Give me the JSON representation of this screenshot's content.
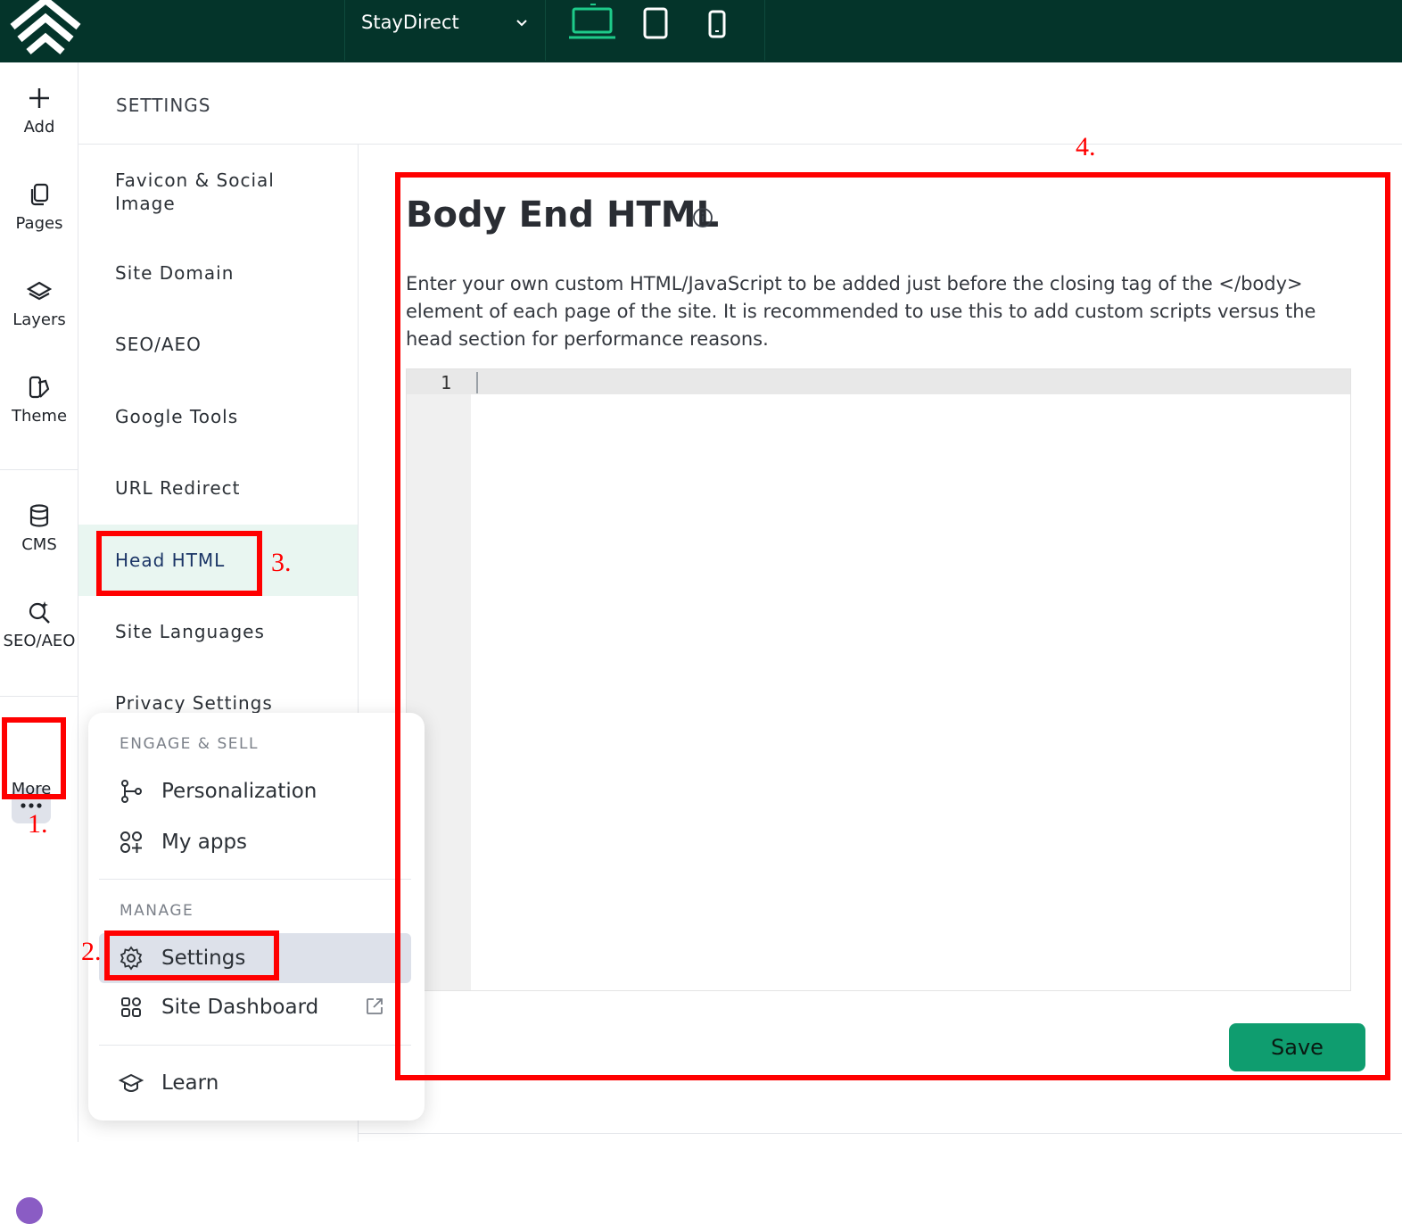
{
  "topbar": {
    "site_name": "StayDirect",
    "devices": [
      "laptop-icon",
      "tablet-icon",
      "phone-icon"
    ],
    "active_device": "laptop-icon",
    "colors": {
      "bg": "#04342a",
      "accent": "#1ecb8a"
    }
  },
  "rail": {
    "items": [
      {
        "label": "Add",
        "icon": "plus-icon"
      },
      {
        "label": "Pages",
        "icon": "pages-icon"
      },
      {
        "label": "Layers",
        "icon": "layers-icon"
      },
      {
        "label": "Theme",
        "icon": "theme-icon"
      },
      {
        "label": "CMS",
        "icon": "database-icon"
      },
      {
        "label": "SEO/AEO",
        "icon": "seo-search-icon"
      },
      {
        "label": "More",
        "icon": "more-dots-icon"
      }
    ]
  },
  "settings": {
    "title": "SETTINGS",
    "nav": [
      {
        "label": "Favicon & Social Image"
      },
      {
        "label": "Site Domain"
      },
      {
        "label": "SEO/AEO"
      },
      {
        "label": "Google Tools"
      },
      {
        "label": "URL Redirect"
      },
      {
        "label": "Head HTML"
      },
      {
        "label": "Site Languages"
      },
      {
        "label": "Privacy Settings"
      }
    ],
    "active_nav": "Head HTML"
  },
  "main": {
    "title": "Body End HTML",
    "description": "Enter your own custom HTML/JavaScript to be added just before the closing tag of the </body> element of each page of the site. It is recommended to use this to add custom scripts versus the head section for performance reasons.",
    "editor": {
      "line_number": "1",
      "content": ""
    },
    "save_label": "Save",
    "colors": {
      "save": "#0f9d6f"
    }
  },
  "menu": {
    "section1": "ENGAGE & SELL",
    "personalization": "Personalization",
    "my_apps": "My apps",
    "section2": "MANAGE",
    "settings": "Settings",
    "site_dashboard": "Site Dashboard",
    "learn": "Learn"
  },
  "annotations": {
    "n1": "1.",
    "n2": "2.",
    "n3": "3.",
    "n4": "4.",
    "color": "#ff0000"
  }
}
